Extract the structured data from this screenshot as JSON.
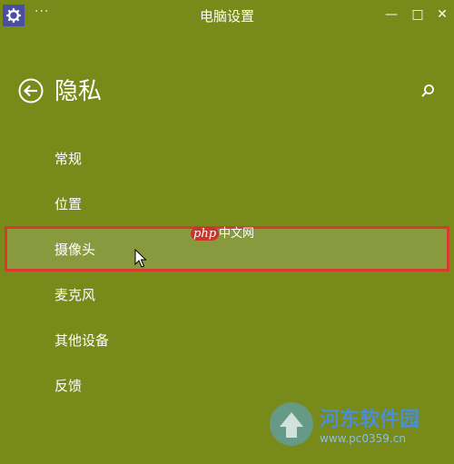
{
  "window": {
    "title": "电脑设置",
    "more_label": "···",
    "minimize_glyph": "—",
    "maximize_glyph": "□",
    "close_glyph": "✕"
  },
  "header": {
    "title": "隐私"
  },
  "nav": {
    "items": [
      {
        "label": "常规"
      },
      {
        "label": "位置"
      },
      {
        "label": "摄像头"
      },
      {
        "label": "麦克风"
      },
      {
        "label": "其他设备"
      },
      {
        "label": "反馈"
      }
    ],
    "selected_index": 2
  },
  "watermarks": {
    "php_brand": "php",
    "php_text": "中文网",
    "site_name": "河东软件园",
    "site_url": "www.pc0359.cn"
  },
  "colors": {
    "background": "#778a1a",
    "selected_bg": "#89993e",
    "selection_border": "#d83a2e",
    "app_icon_bg": "#4b4fa0"
  },
  "icons": {
    "app": "gear-icon",
    "back": "back-arrow-circle-icon",
    "search": "search-icon",
    "cursor": "mouse-pointer-icon"
  }
}
